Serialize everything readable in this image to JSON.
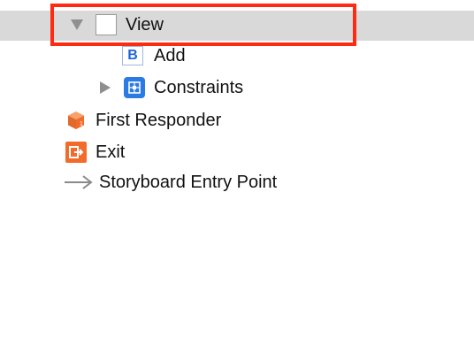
{
  "tree": {
    "view": {
      "label": "View"
    },
    "add": {
      "label": "Add"
    },
    "constraints": {
      "label": "Constraints"
    },
    "first_responder": {
      "label": "First Responder"
    },
    "exit": {
      "label": "Exit"
    },
    "entry_point": {
      "label": "Storyboard Entry Point"
    }
  },
  "icons": {
    "view": "view-icon",
    "add": "button-icon",
    "constraints": "constraints-icon",
    "first_responder": "cube-icon",
    "exit": "exit-icon",
    "entry_point": "arrow-right-icon"
  },
  "colors": {
    "selection_band": "#d9d9d9",
    "highlight_border": "#ff2a12",
    "accent_blue": "#2c7be5",
    "accent_orange": "#f26b2a"
  }
}
